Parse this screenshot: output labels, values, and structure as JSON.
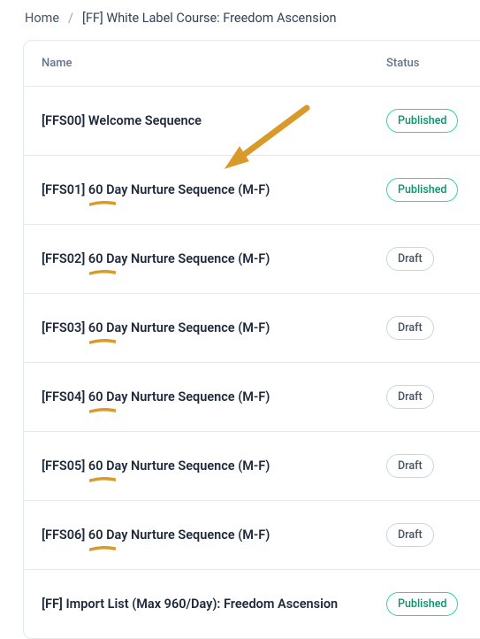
{
  "breadcrumb": {
    "home": "Home",
    "current": "[FF] White Label Course: Freedom Ascension"
  },
  "table": {
    "headers": {
      "name": "Name",
      "status": "Status"
    }
  },
  "rows": [
    {
      "name": "[FFS00] Welcome Sequence",
      "status": "Published",
      "status_kind": "published",
      "mark": false
    },
    {
      "name": "[FFS01] 60 Day Nurture Sequence (M-F)",
      "status": "Published",
      "status_kind": "published",
      "mark": true
    },
    {
      "name": "[FFS02] 60 Day Nurture Sequence (M-F)",
      "status": "Draft",
      "status_kind": "draft",
      "mark": true
    },
    {
      "name": "[FFS03] 60 Day Nurture Sequence (M-F)",
      "status": "Draft",
      "status_kind": "draft",
      "mark": true
    },
    {
      "name": "[FFS04] 60 Day Nurture Sequence (M-F)",
      "status": "Draft",
      "status_kind": "draft",
      "mark": true
    },
    {
      "name": "[FFS05] 60 Day Nurture Sequence (M-F)",
      "status": "Draft",
      "status_kind": "draft",
      "mark": true
    },
    {
      "name": "[FFS06] 60 Day Nurture Sequence (M-F)",
      "status": "Draft",
      "status_kind": "draft",
      "mark": true
    },
    {
      "name": "[FF] Import List (Max 960/Day): Freedom Ascension",
      "status": "Published",
      "status_kind": "published",
      "mark": false
    }
  ],
  "annotation": {
    "arrow_color": "#d99a2b"
  }
}
